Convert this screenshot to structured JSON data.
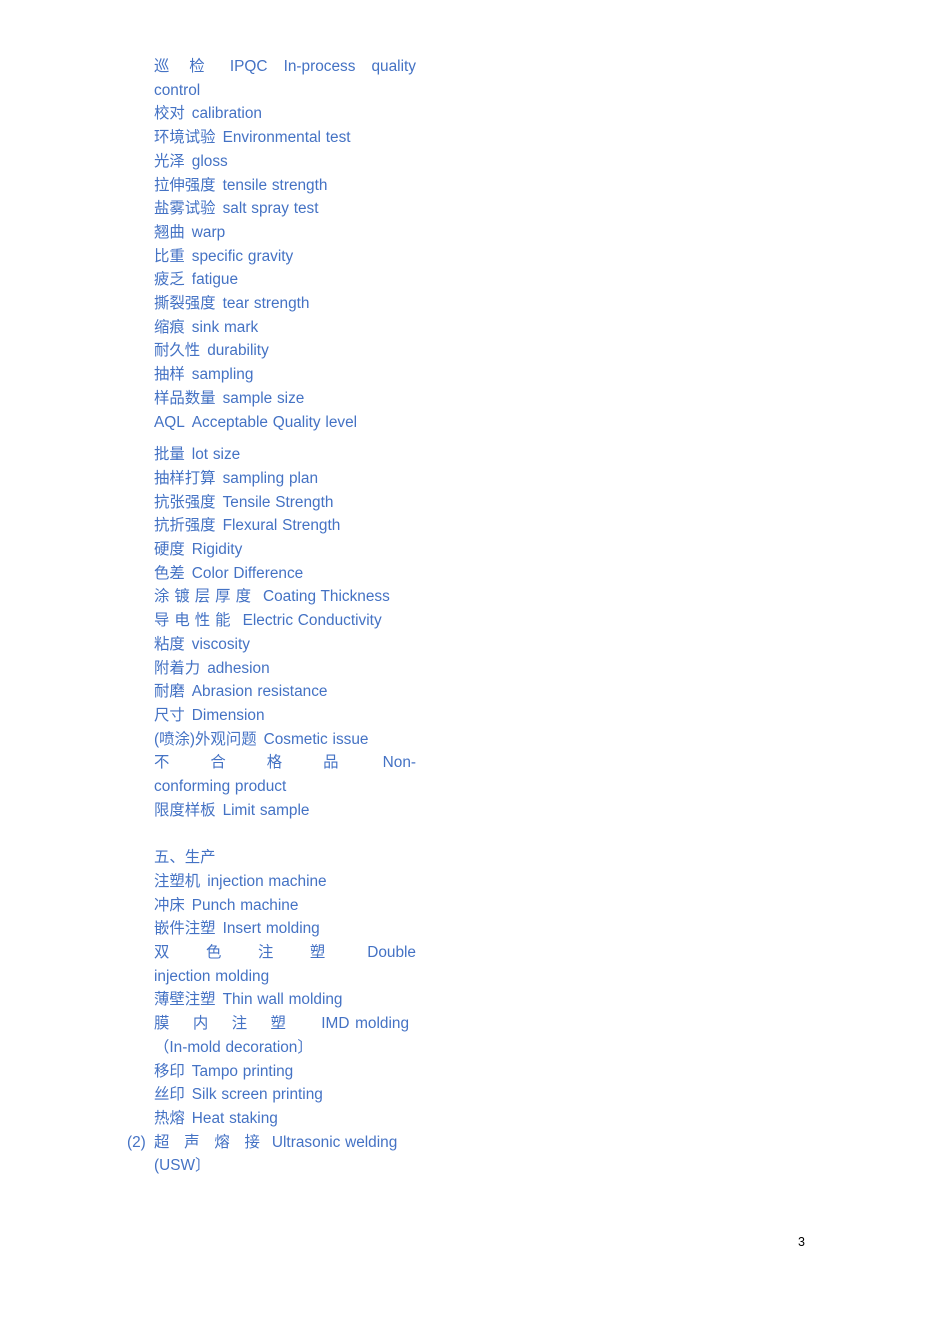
{
  "page": {
    "number": "3",
    "text_color": "#4472c4",
    "page_number_color": "#000000",
    "background": "#ffffff"
  },
  "content": {
    "quality_terms": [
      {
        "cn": "巡 检",
        "en": "IPQC In-process quality control"
      },
      {
        "cn": "校对",
        "en": "calibration"
      },
      {
        "cn": "环境试验",
        "en": "Environmental test"
      },
      {
        "cn": "光泽",
        "en": "gloss"
      },
      {
        "cn": "拉伸强度",
        "en": "tensile strength"
      },
      {
        "cn": "盐雾试验",
        "en": "salt spray test"
      },
      {
        "cn": "翘曲",
        "en": "warp"
      },
      {
        "cn": "比重",
        "en": "specific gravity"
      },
      {
        "cn": "疲乏",
        "en": "fatigue"
      },
      {
        "cn": "撕裂强度",
        "en": "tear strength"
      },
      {
        "cn": "缩痕",
        "en": "sink mark"
      },
      {
        "cn": "耐久性",
        "en": "durability"
      },
      {
        "cn": "抽样",
        "en": "sampling"
      },
      {
        "cn": "样品数量",
        "en": "sample size"
      },
      {
        "cn": "AQL",
        "en": "Acceptable Quality level"
      },
      {
        "cn": "批量",
        "en": "lot size"
      },
      {
        "cn": "抽样打算",
        "en": "sampling plan"
      },
      {
        "cn": "抗张强度",
        "en": "Tensile Strength"
      },
      {
        "cn": "抗折强度",
        "en": "Flexural Strength"
      },
      {
        "cn": "硬度",
        "en": "Rigidity"
      },
      {
        "cn": "色差",
        "en": "Color Difference"
      },
      {
        "cn": "涂镀层厚度",
        "en": "Coating Thickness"
      },
      {
        "cn": "导电性能",
        "en": "Electric Conductivity"
      },
      {
        "cn": "粘度",
        "en": "viscosity"
      },
      {
        "cn": "附着力",
        "en": "adhesion"
      },
      {
        "cn": "耐磨",
        "en": "Abrasion resistance"
      },
      {
        "cn": "尺寸",
        "en": "Dimension"
      },
      {
        "cn": "(喷涂)外观问题",
        "en": "Cosmetic issue"
      },
      {
        "cn": "不 合 格 品",
        "en": "Non-conforming product"
      },
      {
        "cn": "限度样板",
        "en": "Limit sample"
      }
    ],
    "production_heading": "五、生产",
    "production_terms": [
      {
        "cn": "注塑机",
        "en": "injection machine"
      },
      {
        "cn": "冲床",
        "en": "Punch machine"
      },
      {
        "cn": "嵌件注塑",
        "en": "Insert molding"
      },
      {
        "cn": "双 色 注 塑",
        "en": "Double injection molding"
      },
      {
        "cn": "薄壁注塑",
        "en": "Thin wall molding"
      },
      {
        "cn": "膜 内 注 塑",
        "en": "IMD molding（In-mold decoration〕"
      },
      {
        "cn": "移印",
        "en": "Tampo printing"
      },
      {
        "cn": "丝印",
        "en": "Silk screen printing"
      },
      {
        "cn": "热熔",
        "en": "Heat staking"
      },
      {
        "marker": "(2)",
        "cn": "超 声 熔 接",
        "en": "Ultrasonic welding (USW〕"
      }
    ]
  },
  "lines": {
    "l1_cn": "巡",
    "l1_cn2": "检",
    "l1_en": "IPQC In-process quality control",
    "l2_cn": "校对",
    "l2_en": "calibration",
    "l3_cn": "环境试验",
    "l3_en": "Environmental test",
    "l4_cn": "光泽",
    "l4_en": "gloss",
    "l5_cn": "拉伸强度",
    "l5_en": "tensile strength",
    "l6_cn": "盐雾试验",
    "l6_en": "salt spray test",
    "l7_cn": "翘曲",
    "l7_en": "warp",
    "l8_cn": "比重",
    "l8_en": "specific gravity",
    "l9_cn": "疲乏",
    "l9_en": "fatigue",
    "l10_cn": "撕裂强度",
    "l10_en": "tear strength",
    "l11_cn": "缩痕",
    "l11_en": "sink mark",
    "l12_cn": "耐久性",
    "l12_en": "durability",
    "l13_cn": "抽样",
    "l13_en": "sampling",
    "l14_cn": "样品数量",
    "l14_en": "sample size",
    "l15_cn": "AQL",
    "l15_en": "Acceptable Quality level",
    "l16_cn": "批量",
    "l16_en": "lot size",
    "l17_cn": "抽样打算",
    "l17_en": "sampling plan",
    "l18_cn": "抗张强度",
    "l18_en": "Tensile Strength",
    "l19_cn": "抗折强度",
    "l19_en": "Flexural Strength",
    "l20_cn": "硬度",
    "l20_en": "Rigidity",
    "l21_cn": "色差",
    "l21_en": "Color Difference",
    "l22_cn": "涂镀层厚度",
    "l22_en": "Coating Thickness",
    "l23_cn": "导电性能",
    "l23_en": "Electric Conductivity",
    "l24_cn": "粘度",
    "l24_en": "viscosity",
    "l25_cn": "附着力",
    "l25_en": "adhesion",
    "l26_cn": "耐磨",
    "l26_en": "Abrasion resistance",
    "l27_cn": "尺寸",
    "l27_en": "Dimension",
    "l28_cn": "(喷涂)外观问题",
    "l28_en": "Cosmetic issue",
    "l29_cn": "不 合 格 品",
    "l29_en": "Non-conforming product",
    "l30_cn": "限度样板",
    "l30_en": "Limit sample",
    "heading": "五、生产",
    "l31_cn": "注塑机",
    "l31_en": "injection machine",
    "l32_cn": "冲床",
    "l32_en": "Punch machine",
    "l33_cn": "嵌件注塑",
    "l33_en": "Insert molding",
    "l34_cn": "双 色 注 塑",
    "l34_en": "Double injection molding",
    "l35_cn": "薄壁注塑",
    "l35_en": "Thin wall molding",
    "l36_cn": "膜 内 注 塑",
    "l36_en": "IMD molding",
    "l36_en2": "（In-mold decoration〕",
    "l37_cn": "移印",
    "l37_en": "Tampo printing",
    "l38_cn": "丝印",
    "l38_en": "Silk screen printing",
    "l39_cn": "热熔",
    "l39_en": "Heat staking",
    "l40_marker": "(2)",
    "l40_cn": "超 声 熔 接",
    "l40_en": "Ultrasonic welding",
    "l40_en2": "(USW〕"
  }
}
